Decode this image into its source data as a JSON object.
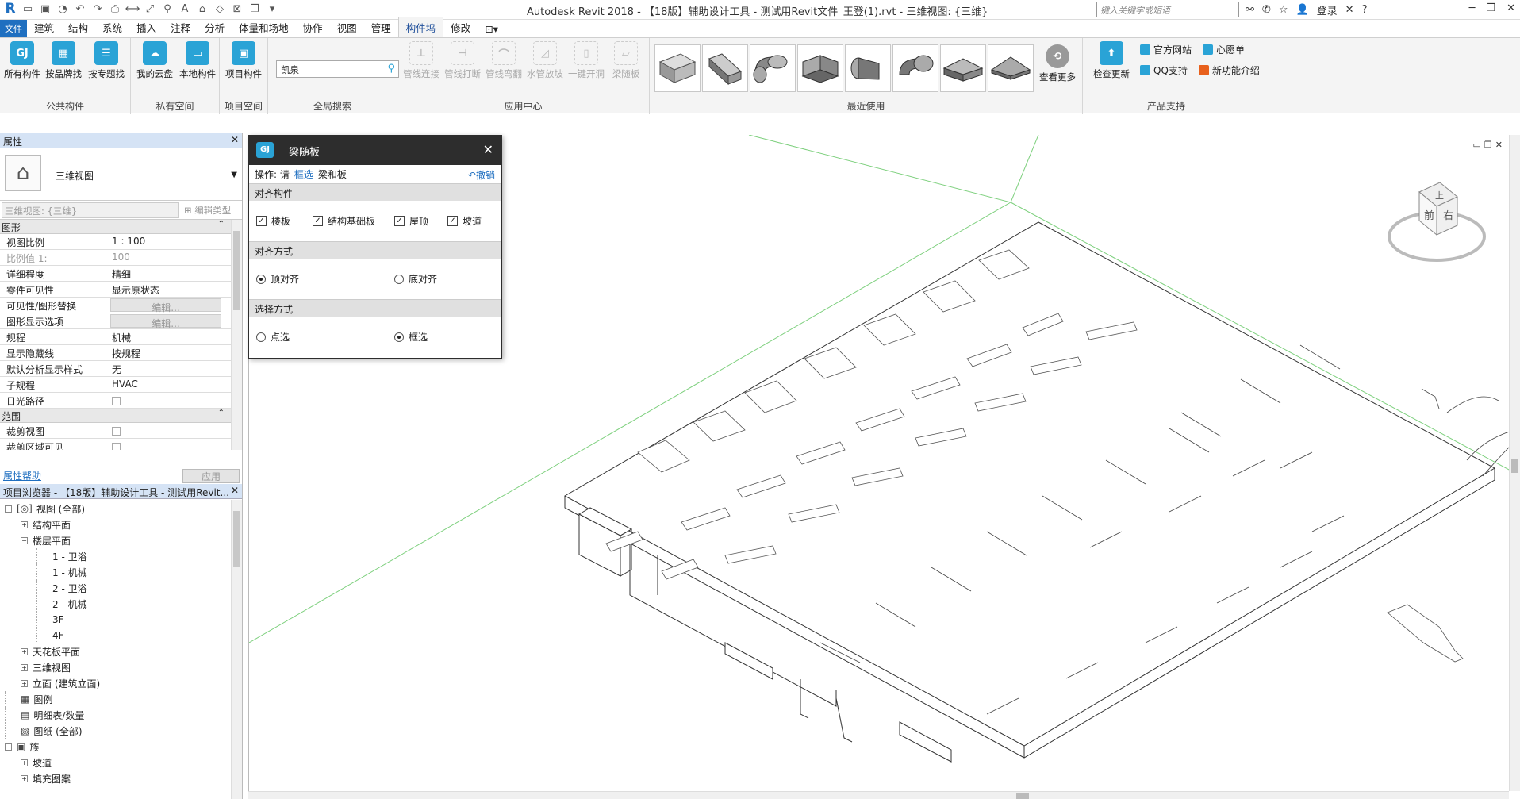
{
  "window": {
    "title": "Autodesk Revit 2018 -  【18版】辅助设计工具 - 测试用Revit文件_王登(1).rvt - 三维视图: {三维}",
    "search_placeholder": "键入关键字或短语",
    "login": "登录"
  },
  "menu": {
    "file": "文件",
    "tabs": [
      "建筑",
      "结构",
      "系统",
      "插入",
      "注释",
      "分析",
      "体量和场地",
      "协作",
      "视图",
      "管理",
      "构件坞",
      "修改"
    ],
    "active": "构件坞"
  },
  "ribbon": {
    "public": {
      "title": "公共构件",
      "buttons": [
        "所有构件",
        "按品牌找",
        "按专题找"
      ]
    },
    "private": {
      "title": "私有空间",
      "buttons": [
        "我的云盘",
        "本地构件"
      ]
    },
    "project": {
      "title": "项目空间",
      "buttons": [
        "项目构件"
      ]
    },
    "global_search": {
      "title": "全局搜索",
      "value": "凯泉"
    },
    "apps": {
      "title": "应用中心",
      "buttons": [
        "管线连接",
        "管线打断",
        "管线弯翻",
        "水管放坡",
        "一键开洞",
        "梁随板"
      ]
    },
    "recent": {
      "title": "最近使用",
      "more": "查看更多"
    },
    "support": {
      "title": "产品支持",
      "check_update": "检查更新",
      "links": [
        "官方网站",
        "心愿单",
        "QQ支持",
        "新功能介绍"
      ]
    }
  },
  "properties": {
    "header": "属性",
    "type_name": "三维视图",
    "selector": "三维视图: {三维}",
    "edit_type": "编辑类型",
    "groups": {
      "graphics": "图形",
      "range": "范围"
    },
    "rows": [
      {
        "k": "视图比例",
        "v": "1 : 100"
      },
      {
        "k": "比例值 1:",
        "v": "100"
      },
      {
        "k": "详细程度",
        "v": "精细"
      },
      {
        "k": "零件可见性",
        "v": "显示原状态"
      },
      {
        "k": "可见性/图形替换",
        "v": "编辑..."
      },
      {
        "k": "图形显示选项",
        "v": "编辑..."
      },
      {
        "k": "规程",
        "v": "机械"
      },
      {
        "k": "显示隐藏线",
        "v": "按规程"
      },
      {
        "k": "默认分析显示样式",
        "v": "无"
      },
      {
        "k": "子规程",
        "v": "HVAC"
      },
      {
        "k": "日光路径",
        "v": ""
      }
    ],
    "range_rows": [
      {
        "k": "裁剪视图",
        "v": ""
      },
      {
        "k": "裁剪区域可见",
        "v": ""
      }
    ],
    "help": "属性帮助",
    "apply": "应用"
  },
  "browser": {
    "header": "项目浏览器 - 【18版】辅助设计工具 - 测试用Revit...",
    "nodes": [
      {
        "label": "视图 (全部)",
        "level": 0,
        "exp": "−",
        "glyph": "[◎]"
      },
      {
        "label": "结构平面",
        "level": 1,
        "exp": "+",
        "glyph": ""
      },
      {
        "label": "楼层平面",
        "level": 1,
        "exp": "−",
        "glyph": ""
      },
      {
        "label": "1 - 卫浴",
        "level": 2,
        "exp": "",
        "glyph": ""
      },
      {
        "label": "1 - 机械",
        "level": 2,
        "exp": "",
        "glyph": ""
      },
      {
        "label": "2 - 卫浴",
        "level": 2,
        "exp": "",
        "glyph": ""
      },
      {
        "label": "2 - 机械",
        "level": 2,
        "exp": "",
        "glyph": ""
      },
      {
        "label": "3F",
        "level": 2,
        "exp": "",
        "glyph": ""
      },
      {
        "label": "4F",
        "level": 2,
        "exp": "",
        "glyph": ""
      },
      {
        "label": "天花板平面",
        "level": 1,
        "exp": "+",
        "glyph": ""
      },
      {
        "label": "三维视图",
        "level": 1,
        "exp": "+",
        "glyph": ""
      },
      {
        "label": "立面 (建筑立面)",
        "level": 1,
        "exp": "+",
        "glyph": ""
      },
      {
        "label": "图例",
        "level": 0,
        "exp": "",
        "glyph": "▦"
      },
      {
        "label": "明细表/数量",
        "level": 0,
        "exp": "",
        "glyph": "▤"
      },
      {
        "label": "图纸 (全部)",
        "level": 0,
        "exp": "",
        "glyph": "▧"
      },
      {
        "label": "族",
        "level": 0,
        "exp": "−",
        "glyph": "▣"
      },
      {
        "label": "坡道",
        "level": 1,
        "exp": "+",
        "glyph": ""
      },
      {
        "label": "填充图案",
        "level": 1,
        "exp": "+",
        "glyph": ""
      }
    ]
  },
  "dialog": {
    "title": "梁随板",
    "ops_label": "操作: 请",
    "ops_highlight": "框选",
    "ops_suffix": "梁和板",
    "undo": "撤销",
    "sec_align_elem": "对齐构件",
    "elements": [
      "楼板",
      "结构基础板",
      "屋顶",
      "坡道"
    ],
    "sec_align_mode": "对齐方式",
    "align_top": "顶对齐",
    "align_bottom": "底对齐",
    "sec_select_mode": "选择方式",
    "pick": "点选",
    "box": "框选"
  },
  "viewcube": {
    "top": "上",
    "front": "前",
    "right": "右"
  },
  "colors": {
    "accent": "#1f6fc0",
    "ribbon_icon": "#2aa3d6",
    "dialog_header": "#2d2d2d"
  }
}
